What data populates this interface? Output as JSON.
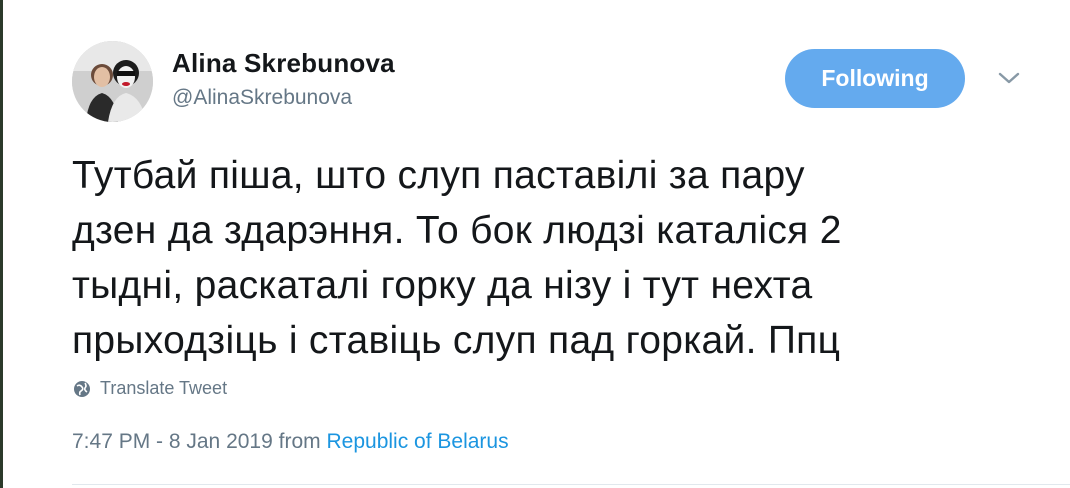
{
  "author": {
    "display_name": "Alina Skrebunova",
    "handle": "@AlinaSkrebunova"
  },
  "follow_button": {
    "label": "Following",
    "color": "#64aaee"
  },
  "menu": {
    "icon": "chevron-down-icon"
  },
  "tweet": {
    "lines": [
      "Тутбай піша, што слуп паставілі за пару",
      "дзен да здарэння. То бок людзі каталіся 2",
      "тыдні, раскаталі горку да нізу і тут нехта",
      "прыходзіць і ставіць слуп пад горкай. Ппц"
    ]
  },
  "translate": {
    "label": "Translate Tweet",
    "icon": "globe-icon"
  },
  "meta": {
    "timestamp": "7:47 PM - 8 Jan 2019",
    "from_label": "from",
    "location": "Republic of Belarus"
  },
  "colors": {
    "text": "#14171a",
    "secondary": "#657786",
    "link": "#1b95e0"
  }
}
